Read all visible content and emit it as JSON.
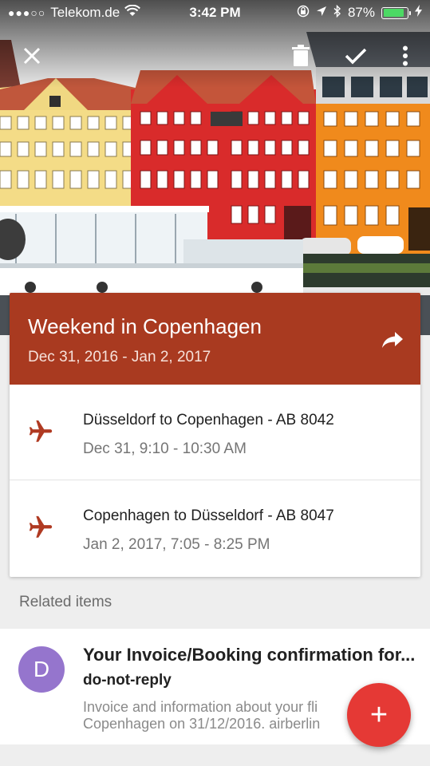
{
  "status_bar": {
    "signal_dots": "●●●○○",
    "carrier": "Telekom.de",
    "time": "3:42 PM",
    "battery": "87%",
    "battery_level": 0.87,
    "battery_color": "#4cd964"
  },
  "toolbar": {
    "close_icon": "close-icon",
    "delete_icon": "trash-icon",
    "done_icon": "check-icon",
    "more_icon": "more-vert-icon"
  },
  "trip": {
    "title": "Weekend in Copenhagen",
    "dates": "Dec 31, 2016 - Jan 2, 2017",
    "header_color": "#a93a20",
    "share_icon": "share-icon",
    "flights": [
      {
        "icon": "airplane-icon",
        "title": "Düsseldorf to Copenhagen - AB 8042",
        "time": "Dec 31, 9:10 - 10:30 AM"
      },
      {
        "icon": "airplane-icon",
        "title": "Copenhagen to Düsseldorf - AB 8047",
        "time": "Jan 2, 2017, 7:05 - 8:25 PM"
      }
    ]
  },
  "related": {
    "label": "Related items",
    "items": [
      {
        "avatar_letter": "D",
        "avatar_color": "#9575cd",
        "title": "Your Invoice/Booking confirmation for...",
        "sender": "do-not-reply",
        "snippet_line1": "Invoice and information about your fli",
        "snippet_line2": "Copenhagen on 31/12/2016. airberlin"
      }
    ]
  },
  "fab": {
    "label": "+",
    "color": "#e53935"
  }
}
